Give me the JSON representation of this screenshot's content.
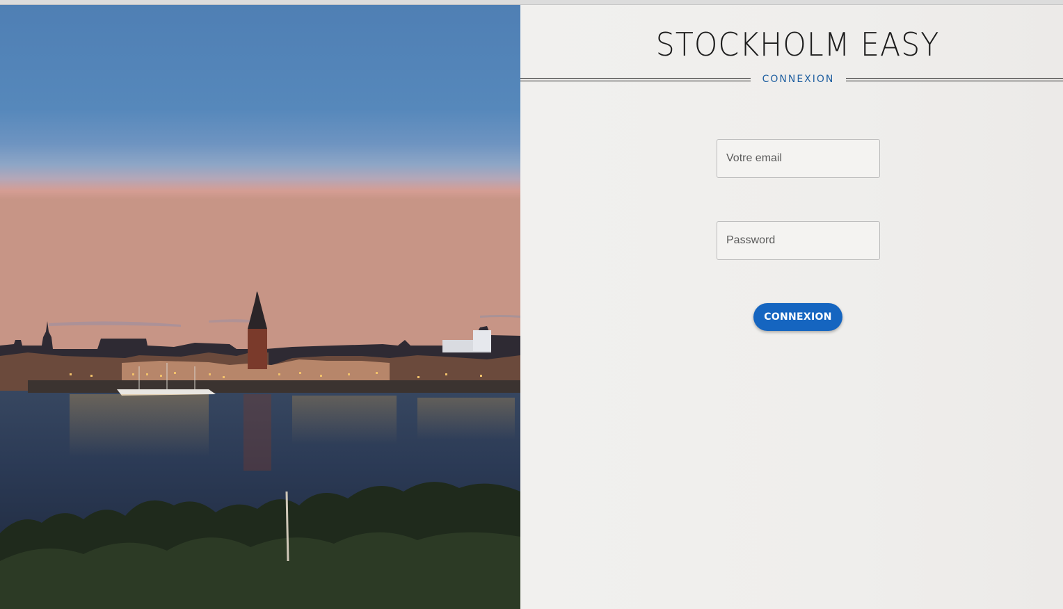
{
  "app": {
    "title": "STOCKHOLM EASY",
    "subtitle": "CONNEXION"
  },
  "hero": {
    "image": "stockholm-city-skyline-at-dusk"
  },
  "form": {
    "email_placeholder": "Votre email",
    "email_value": "",
    "password_placeholder": "Password",
    "password_value": "",
    "submit_label": "CONNEXION"
  },
  "colors": {
    "accent": "#1565c0",
    "subtitle": "#1f5fa0",
    "panel_background": "#f0efed",
    "title": "#1d1d1d"
  }
}
